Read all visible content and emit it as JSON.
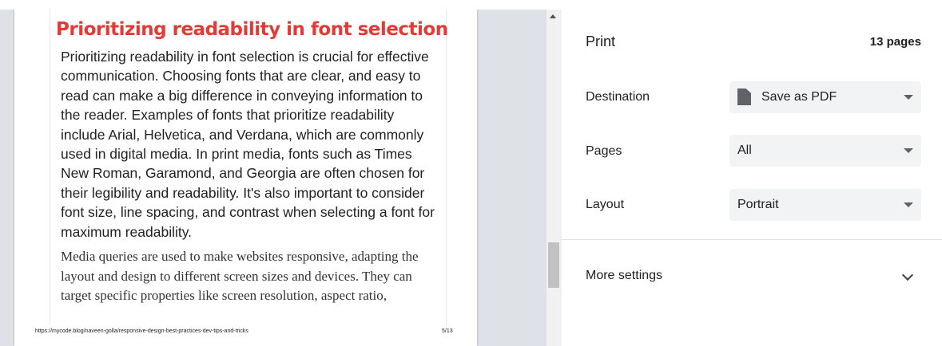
{
  "preview": {
    "heading": "Prioritizing readability in font selection",
    "paragraph_1": "Prioritizing readability in font selection is crucial for effective communication. Choosing fonts that are clear, and easy to read can make a big difference in conveying information to the reader. Examples of fonts that prioritize readability include Arial, Helvetica, and Verdana, which are commonly used in digital media. In print media, fonts such as Times New Roman, Garamond, and Georgia are often chosen for their legibility and readability. It's also important to consider font size, line spacing, and contrast when selecting a font for maximum readability.",
    "paragraph_2": "Media queries are used to make websites responsive, adapting the layout and design to different screen sizes and devices. They can target specific properties like screen resolution, aspect ratio,",
    "footer_url": "https://mycode.blog/naveen-golla/responsive-design-best-practices-dev-tips-and-tricks",
    "page_number": "5/13"
  },
  "print_panel": {
    "title": "Print",
    "page_count": "13 pages",
    "destination": {
      "label": "Destination",
      "value": "Save as PDF",
      "icon": "file-icon"
    },
    "pages": {
      "label": "Pages",
      "value": "All"
    },
    "layout": {
      "label": "Layout",
      "value": "Portrait"
    },
    "more_settings": "More settings"
  },
  "colors": {
    "heading": "#e53935",
    "preview_background": "#dee1e6",
    "select_background": "#f1f3f4"
  }
}
